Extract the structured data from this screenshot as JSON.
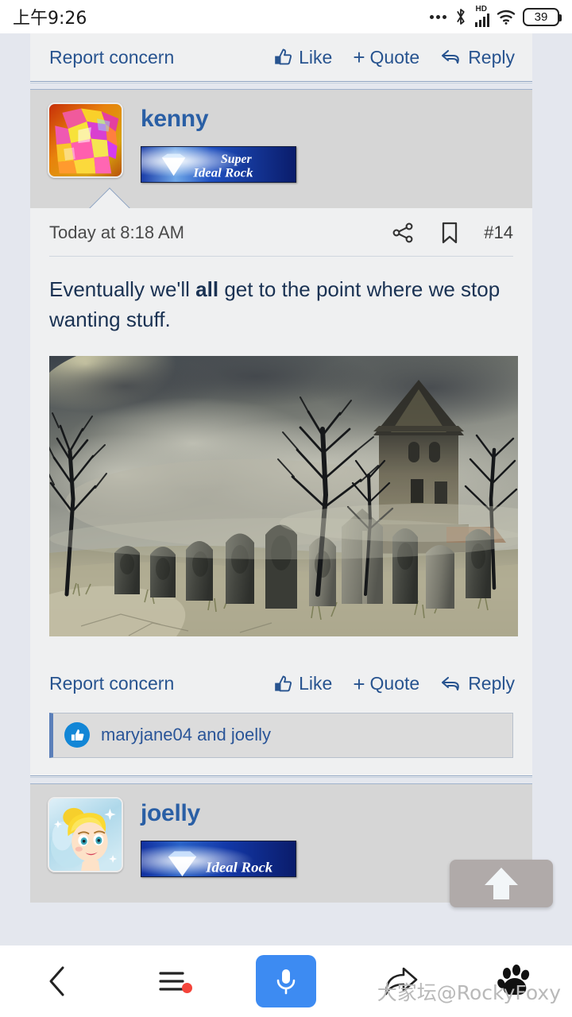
{
  "status_bar": {
    "time": "上午9:26",
    "hd_label": "HD",
    "battery_level": "39",
    "icons": [
      "more-dots-icon",
      "bluetooth-icon",
      "hd-signal-icon",
      "wifi-icon",
      "battery-icon"
    ]
  },
  "top_action_bar": {
    "report": "Report concern",
    "like": "Like",
    "quote": "Quote",
    "quote_plus": "+",
    "reply": "Reply"
  },
  "post": {
    "username": "kenny",
    "badge_line1": "Super",
    "badge_line2": "Ideal Rock",
    "date": "Today at 8:18 AM",
    "post_number": "#14",
    "text_before_bold": "Eventually we'll ",
    "text_bold": "all",
    "text_after_bold": " get to the point where we stop wanting stuff.",
    "image_alt": "haunted cemetery with gravestones and gothic mansion",
    "actions": {
      "report": "Report concern",
      "like": "Like",
      "quote": "Quote",
      "quote_plus": "+",
      "reply": "Reply"
    },
    "likes_text": "maryjane04 and joelly"
  },
  "next_post": {
    "username": "joelly",
    "badge_text": "Ideal Rock"
  },
  "scroll_top_button": {
    "name": "scroll-to-top"
  },
  "watermark": {
    "text": "大家坛@RockyFoxy"
  },
  "bottom_nav": {
    "items": [
      "back-icon",
      "menu-icon",
      "microphone-icon",
      "share-icon",
      "paw-icon"
    ]
  },
  "colors": {
    "link_blue": "#27538f",
    "username_blue": "#2a5fa5",
    "body_bg": "#eff0f1",
    "page_bg": "#e4e7ee",
    "header_bg": "#d6d6d6",
    "mic_blue": "#3d8bf2",
    "badge_red_dot": "#f4443a",
    "like_circle": "#1286d6"
  }
}
